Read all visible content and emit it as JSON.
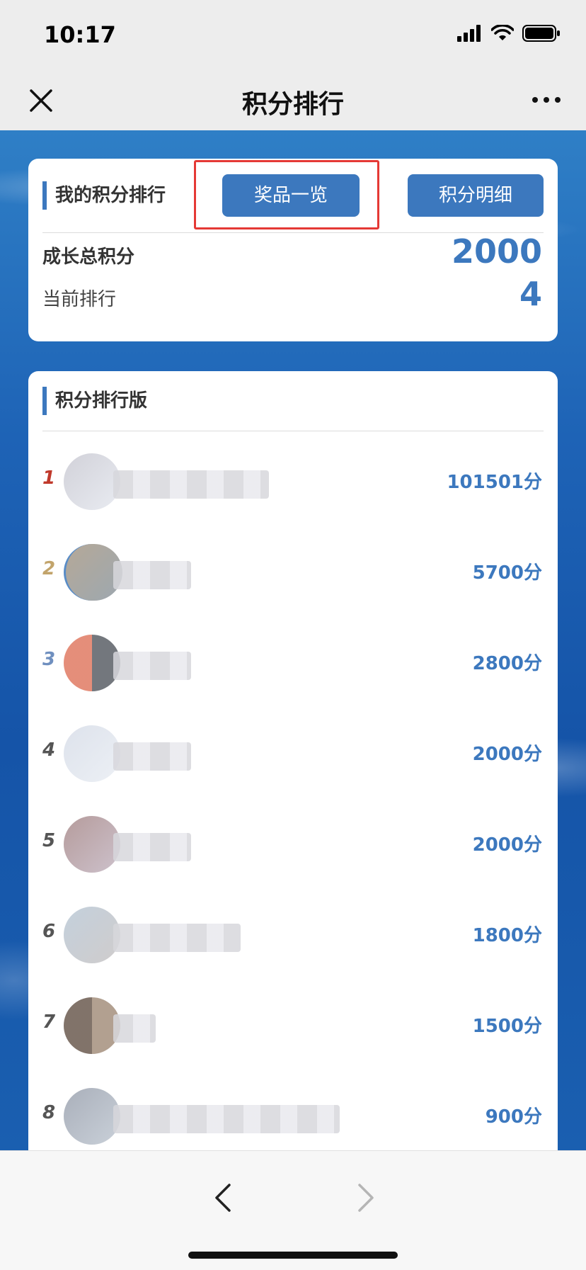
{
  "status": {
    "time": "10:17"
  },
  "nav": {
    "title": "积分排行"
  },
  "my_rank": {
    "section_title": "我的积分排行",
    "prizes_button": "奖品一览",
    "detail_button": "积分明细",
    "total_label": "成长总积分",
    "total_value": "2000",
    "rank_label": "当前排行",
    "rank_value": "4"
  },
  "leaderboard": {
    "section_title": "积分排行版",
    "rows": [
      {
        "rank": "1",
        "score": "101501分",
        "rank_color": "#c0392b"
      },
      {
        "rank": "2",
        "score": "5700分",
        "rank_color": "#c2a46b"
      },
      {
        "rank": "3",
        "score": "2800分",
        "rank_color": "#6f8fbf"
      },
      {
        "rank": "4",
        "score": "2000分",
        "rank_color": "#555555"
      },
      {
        "rank": "5",
        "score": "2000分",
        "rank_color": "#555555"
      },
      {
        "rank": "6",
        "score": "1800分",
        "rank_color": "#555555"
      },
      {
        "rank": "7",
        "score": "1500分",
        "rank_color": "#555555"
      },
      {
        "rank": "8",
        "score": "900分",
        "rank_color": "#555555"
      }
    ]
  },
  "colors": {
    "accent": "#3c78be",
    "highlight": "#e53935"
  }
}
